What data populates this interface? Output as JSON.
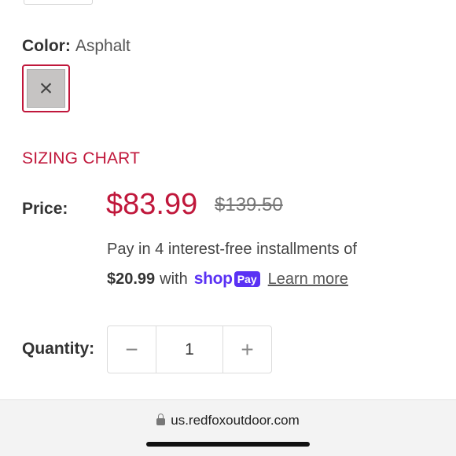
{
  "color": {
    "label": "Color:",
    "value": "Asphalt",
    "swatch_mark": "×",
    "swatch_color": "#c6c4c3"
  },
  "sizing_chart": "SIZING CHART",
  "price": {
    "label": "Price:",
    "current": "$83.99",
    "compare_at": "$139.50",
    "accent_color": "#c0173b"
  },
  "installments": {
    "text": "Pay in 4 interest-free installments of",
    "amount": "$20.99",
    "with": "with",
    "logo_shop": "shop",
    "logo_pay": "Pay",
    "learn_more": "Learn more",
    "brand_color": "#5a31f4"
  },
  "quantity": {
    "label": "Quantity:",
    "value": "1",
    "minus": "−",
    "plus": "+"
  },
  "browser": {
    "url": "us.redfoxoutdoor.com"
  }
}
